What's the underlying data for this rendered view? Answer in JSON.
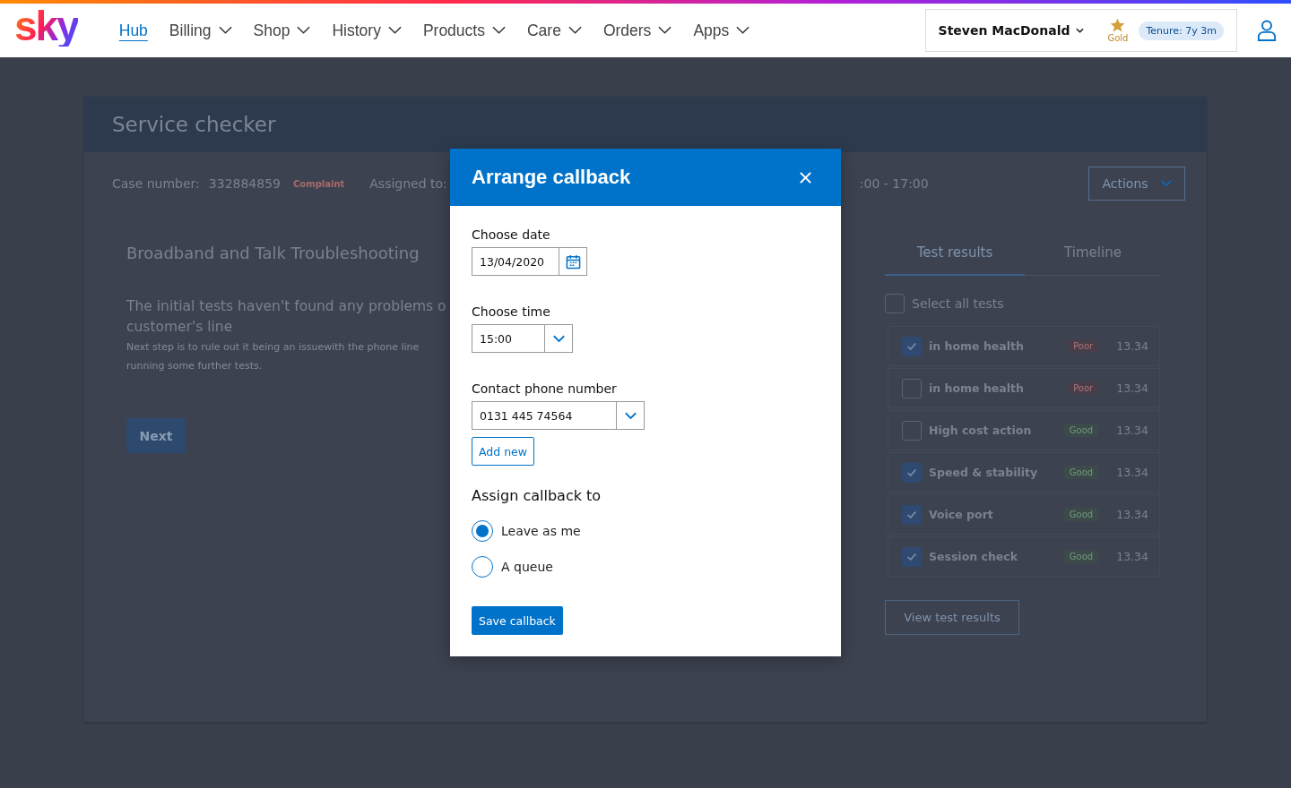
{
  "header": {
    "logo": "sky",
    "nav": [
      {
        "label": "Hub",
        "selected": true,
        "has_menu": false
      },
      {
        "label": "Billing",
        "selected": false,
        "has_menu": true
      },
      {
        "label": "Shop",
        "selected": false,
        "has_menu": true
      },
      {
        "label": "History",
        "selected": false,
        "has_menu": true
      },
      {
        "label": "Products",
        "selected": false,
        "has_menu": true
      },
      {
        "label": "Care",
        "selected": false,
        "has_menu": true
      },
      {
        "label": "Orders",
        "selected": false,
        "has_menu": true
      },
      {
        "label": "Apps",
        "selected": false,
        "has_menu": true
      }
    ],
    "customer": {
      "name": "Steven MacDonald",
      "tier": "Gold",
      "tenure": "Tenure: 7y 3m"
    }
  },
  "page": {
    "title": "Service checker",
    "case": {
      "label": "Case number:",
      "number": "332884859",
      "tag": "Complaint",
      "assigned": "Assigned to:",
      "hours": ":00 - 17:00",
      "actions": "Actions"
    },
    "panel": {
      "title": "Broadband and Talk Troubleshooting",
      "heading": [
        "The initial tests haven't found any problems o",
        "customer's line"
      ],
      "body": [
        "Next step is to rule out it being an issuewith the phone line",
        "running some further tests."
      ],
      "next": "Next"
    },
    "tabs": [
      {
        "label": "Test results",
        "selected": true
      },
      {
        "label": "Timeline",
        "selected": false
      }
    ],
    "select_all": {
      "label": "Select all tests",
      "checked": false
    },
    "tests": [
      {
        "name": "in home health",
        "checked": true,
        "status": "Poor",
        "kind": "poor",
        "time": "13.34"
      },
      {
        "name": "in home health",
        "checked": false,
        "status": "Poor",
        "kind": "poor",
        "time": "13.34"
      },
      {
        "name": "High cost action",
        "checked": false,
        "status": "Good",
        "kind": "good",
        "time": "13.34"
      },
      {
        "name": "Speed & stability",
        "checked": true,
        "status": "Good",
        "kind": "good",
        "time": "13.34"
      },
      {
        "name": "Voice port",
        "checked": true,
        "status": "Good",
        "kind": "good",
        "time": "13.34"
      },
      {
        "name": "Session check",
        "checked": true,
        "status": "Good",
        "kind": "good",
        "time": "13.34"
      }
    ],
    "view_results": "View test results"
  },
  "dialog": {
    "title": "Arrange callback",
    "date": {
      "label": "Choose date",
      "value": "13/04/2020"
    },
    "time": {
      "label": "Choose time",
      "value": "15:00"
    },
    "phone": {
      "label": "Contact phone number",
      "value": "0131 445 74564",
      "add": "Add new"
    },
    "assign": {
      "label": "Assign callback to",
      "options": [
        {
          "label": "Leave as me",
          "selected": true
        },
        {
          "label": "A queue",
          "selected": false
        }
      ]
    },
    "save": "Save callback"
  }
}
